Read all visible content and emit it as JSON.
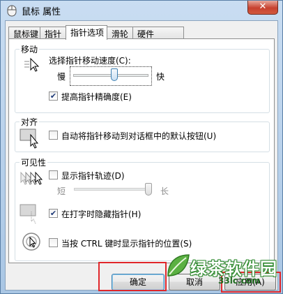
{
  "window": {
    "title": "鼠标 属性",
    "close_glyph": "✕"
  },
  "tabs": [
    {
      "label": "鼠标键"
    },
    {
      "label": "指针"
    },
    {
      "label": "指针选项",
      "active": true
    },
    {
      "label": "滑轮"
    },
    {
      "label": "硬件"
    }
  ],
  "motion": {
    "title": "移动",
    "speed_label": "选择指针移动速度(C):",
    "slow": "慢",
    "fast": "快",
    "speed_value": 0.55,
    "precision_label": "提高指针精确度(E)",
    "precision_checked": true
  },
  "snap": {
    "title": "对齐",
    "label": "自动将指针移动到对话框中的默认按钮(U)",
    "checked": false
  },
  "visibility": {
    "title": "可见性",
    "trails_label": "显示指针轨迹(D)",
    "trails_checked": false,
    "short": "短",
    "long": "长",
    "trails_value": 1.0,
    "hide_label": "在打字时隐藏指针(H)",
    "hide_checked": true,
    "ctrl_label": "当按 CTRL 键时显示指针的位置(S)",
    "ctrl_checked": false
  },
  "buttons": {
    "ok": "确定",
    "cancel": "取消",
    "apply": "应用(A)"
  },
  "watermark": {
    "text": "绿茶软件园",
    "domain": "33lc.com"
  },
  "colors": {
    "highlight": "#e0262a",
    "accent": "#3c7fb1"
  }
}
